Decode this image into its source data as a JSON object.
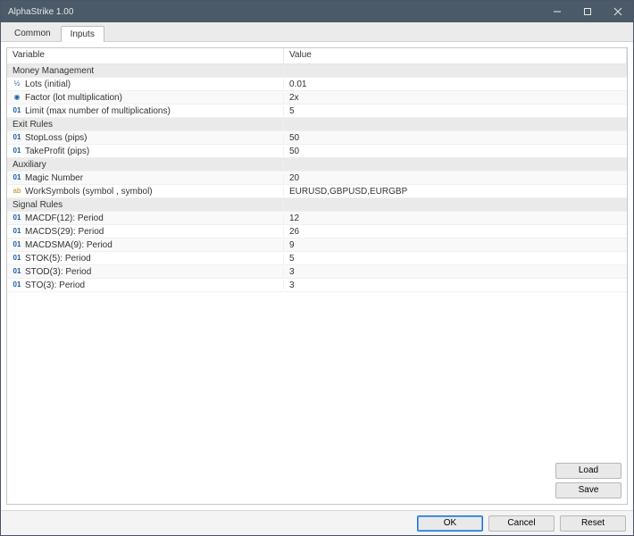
{
  "window": {
    "title": "AlphaStrike 1.00"
  },
  "tabs": {
    "common": "Common",
    "inputs": "Inputs"
  },
  "headers": {
    "variable": "Variable",
    "value": "Value"
  },
  "groups": [
    {
      "label": "Money Management",
      "items": [
        {
          "icon": "half",
          "name": "Lots (initial)",
          "value": "0.01"
        },
        {
          "icon": "dot",
          "name": "Factor (lot multiplication)",
          "value": "2x"
        },
        {
          "icon": "num",
          "name": "Limit (max number of multiplications)",
          "value": "5"
        }
      ]
    },
    {
      "label": "Exit Rules",
      "items": [
        {
          "icon": "num",
          "name": "StopLoss (pips)",
          "value": "50"
        },
        {
          "icon": "num",
          "name": "TakeProfit (pips)",
          "value": "50"
        }
      ]
    },
    {
      "label": "Auxiliary",
      "items": [
        {
          "icon": "num",
          "name": "Magic Number",
          "value": "20"
        },
        {
          "icon": "str",
          "name": "WorkSymbols (symbol , symbol)",
          "value": "EURUSD,GBPUSD,EURGBP"
        }
      ]
    },
    {
      "label": "Signal Rules",
      "items": [
        {
          "icon": "num",
          "name": "MACDF(12): Period",
          "value": "12"
        },
        {
          "icon": "num",
          "name": "MACDS(29): Period",
          "value": "26"
        },
        {
          "icon": "num",
          "name": "MACDSMA(9): Period",
          "value": "9"
        },
        {
          "icon": "num",
          "name": "STOK(5): Period",
          "value": "5"
        },
        {
          "icon": "num",
          "name": "STOD(3): Period",
          "value": "3"
        },
        {
          "icon": "num",
          "name": "STO(3): Period",
          "value": "3"
        }
      ]
    }
  ],
  "buttons": {
    "load": "Load",
    "save": "Save",
    "ok": "OK",
    "cancel": "Cancel",
    "reset": "Reset"
  }
}
